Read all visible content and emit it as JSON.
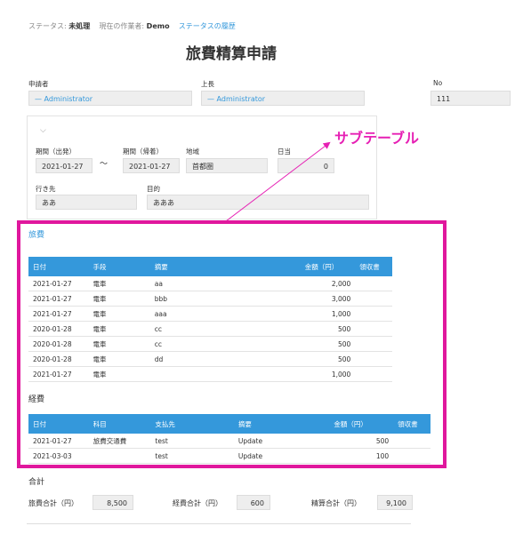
{
  "header": {
    "status_label": "ステータス:",
    "status_value": "未処理",
    "worker_label": "現在の作業者:",
    "worker_value": "Demo",
    "history_link": "ステータスの履歴"
  },
  "page_title": "旅費精算申請",
  "form": {
    "applicant_label": "申請者",
    "applicant_value": "Administrator",
    "manager_label": "上長",
    "manager_value": "Administrator",
    "no_label": "No",
    "no_value": "111"
  },
  "trip": {
    "period_start_label": "期間（出発）",
    "period_start_value": "2021-01-27",
    "tilde": "〜",
    "period_end_label": "期間（帰着）",
    "period_end_value": "2021-01-27",
    "region_label": "地域",
    "region_value": "首都圏",
    "per_diem_label": "日当",
    "per_diem_value": "0",
    "destination_label": "行き先",
    "destination_value": "ああ",
    "purpose_label": "目的",
    "purpose_value": "あああ"
  },
  "annotation": "サブテーブル",
  "travel": {
    "title": "旅費",
    "headers": [
      "日付",
      "手段",
      "摘要",
      "金額（円）",
      "領収書"
    ],
    "rows": [
      [
        "2021-01-27",
        "電車",
        "aa",
        "2,000",
        ""
      ],
      [
        "2021-01-27",
        "電車",
        "bbb",
        "3,000",
        ""
      ],
      [
        "2021-01-27",
        "電車",
        "aaa",
        "1,000",
        ""
      ],
      [
        "2020-01-28",
        "電車",
        "cc",
        "500",
        ""
      ],
      [
        "2020-01-28",
        "電車",
        "cc",
        "500",
        ""
      ],
      [
        "2020-01-28",
        "電車",
        "dd",
        "500",
        ""
      ],
      [
        "2021-01-27",
        "電車",
        "",
        "1,000",
        ""
      ]
    ]
  },
  "expense": {
    "title": "経費",
    "headers": [
      "日付",
      "科目",
      "支払先",
      "摘要",
      "金額（円）",
      "領収書"
    ],
    "rows": [
      [
        "2021-01-27",
        "旅費交通費",
        "test",
        "Update",
        "500",
        ""
      ],
      [
        "2021-03-03",
        "",
        "test",
        "Update",
        "100",
        ""
      ]
    ]
  },
  "totals": {
    "title": "合計",
    "travel_label": "旅費合計（円）",
    "travel_value": "8,500",
    "expense_label": "経費合計（円）",
    "expense_value": "600",
    "settle_label": "精算合計（円）",
    "settle_value": "9,100"
  },
  "colors": {
    "accent": "#3498db",
    "highlight": "#e0179d"
  }
}
